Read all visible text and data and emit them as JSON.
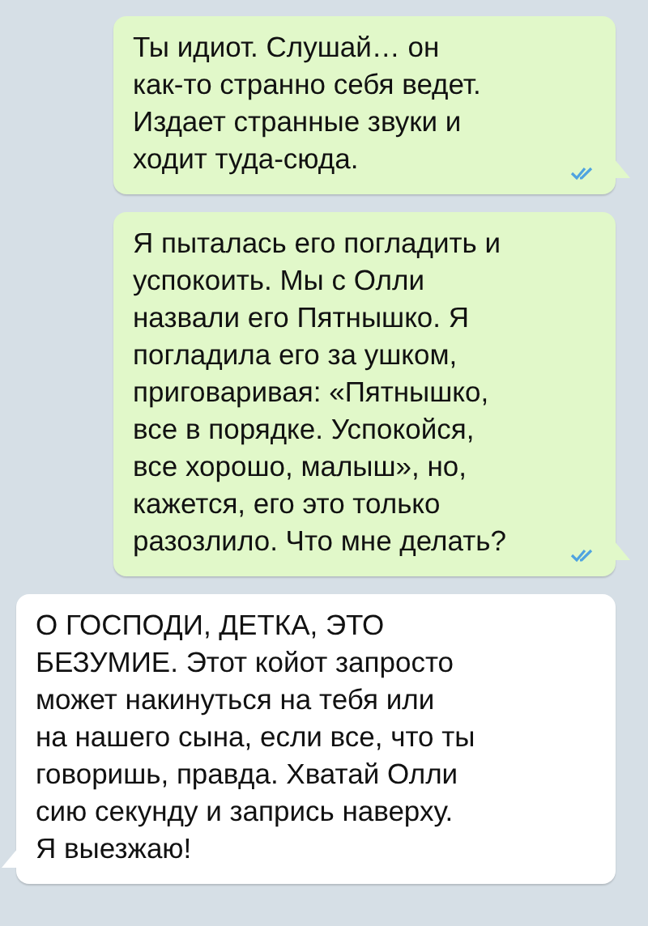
{
  "messages": [
    {
      "kind": "outgoing",
      "read": true,
      "text": "Ты идиот. Слушай… он\nкак-то странно себя ведет.\nИздает странные звуки и\nходит туда-сюда."
    },
    {
      "kind": "outgoing",
      "read": true,
      "text": "Я пыталась его погладить и\nуспокоить. Мы с Олли\nназвали его Пятнышко. Я\nпогладила его за ушком,\nприговаривая: «Пятнышко,\nвсе в порядке. Успокойся,\nвсе хорошо, малыш», но,\nкажется, его это только\nразозлило. Что мне делать?"
    },
    {
      "kind": "incoming",
      "read": false,
      "text": "О ГОСПОДИ, ДЕТКА, ЭТО\nБЕЗУМИЕ. Этот койот запросто\nможет накинуться на тебя или\nна нашего сына, если все, что ты\nговоришь, правда. Хватай Олли\nсию секунду и запрись наверху.\nЯ выезжаю!"
    }
  ]
}
